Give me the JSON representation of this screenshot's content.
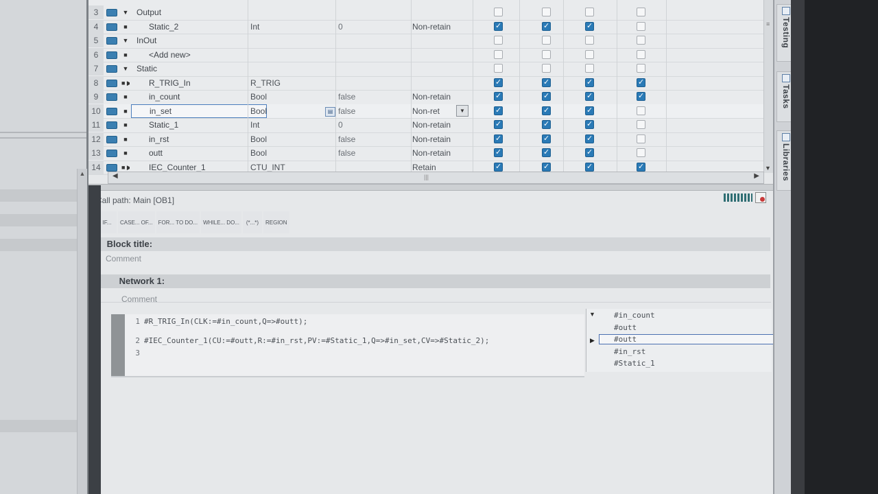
{
  "variables": [
    {
      "num": "3",
      "name": "Output",
      "type": "",
      "value": "",
      "retain": "",
      "tri": "▼",
      "indent": 0,
      "checks": [
        false,
        false,
        false,
        false
      ]
    },
    {
      "num": "4",
      "name": "Static_2",
      "type": "Int",
      "value": "0",
      "retain": "Non-retain",
      "tri": "■",
      "indent": 1,
      "checks": [
        true,
        true,
        true,
        false
      ]
    },
    {
      "num": "5",
      "name": "InOut",
      "type": "",
      "value": "",
      "retain": "",
      "tri": "▼",
      "indent": 0,
      "checks": [
        false,
        false,
        false,
        false
      ]
    },
    {
      "num": "6",
      "name": "<Add new>",
      "type": "",
      "value": "",
      "retain": "",
      "tri": "■",
      "indent": 1,
      "checks": [
        false,
        false,
        false,
        false
      ]
    },
    {
      "num": "7",
      "name": "Static",
      "type": "",
      "value": "",
      "retain": "",
      "tri": "▼",
      "indent": 0,
      "checks": [
        false,
        false,
        false,
        false
      ]
    },
    {
      "num": "8",
      "name": "R_TRIG_In",
      "type": "R_TRIG",
      "value": "",
      "retain": "",
      "tri": "■ ▶",
      "indent": 1,
      "checks": [
        true,
        true,
        true,
        true
      ]
    },
    {
      "num": "9",
      "name": "in_count",
      "type": "Bool",
      "value": "false",
      "retain": "Non-retain",
      "tri": "■",
      "indent": 1,
      "checks": [
        true,
        true,
        true,
        true
      ]
    },
    {
      "num": "10",
      "name": "in_set",
      "type": "Bool",
      "value": "false",
      "retain": "Non-ret",
      "tri": "■",
      "indent": 1,
      "checks": [
        true,
        true,
        true,
        false
      ]
    },
    {
      "num": "11",
      "name": "Static_1",
      "type": "Int",
      "value": "0",
      "retain": "Non-retain",
      "tri": "■",
      "indent": 1,
      "checks": [
        true,
        true,
        true,
        false
      ]
    },
    {
      "num": "12",
      "name": "in_rst",
      "type": "Bool",
      "value": "false",
      "retain": "Non-retain",
      "tri": "■",
      "indent": 1,
      "checks": [
        true,
        true,
        true,
        false
      ]
    },
    {
      "num": "13",
      "name": "outt",
      "type": "Bool",
      "value": "false",
      "retain": "Non-retain",
      "tri": "■",
      "indent": 1,
      "checks": [
        true,
        true,
        true,
        false
      ]
    },
    {
      "num": "14",
      "name": "IEC_Counter_1",
      "type": "CTU_INT",
      "value": "",
      "retain": "Retain",
      "tri": "■ ▶",
      "indent": 1,
      "checks": [
        true,
        true,
        true,
        true
      ]
    }
  ],
  "call_path": "Call path: Main [OB1]",
  "toolbar": [
    {
      "label": "IF...",
      "name": "if-button"
    },
    {
      "label": "CASE... OF...",
      "name": "case-of-button"
    },
    {
      "label": "FOR... TO DO...",
      "name": "for-to-do-button"
    },
    {
      "label": "WHILE... DO...",
      "name": "while-do-button"
    },
    {
      "label": "(*...*)",
      "name": "comment-block-button"
    },
    {
      "label": "REGION",
      "name": "region-button"
    }
  ],
  "block": {
    "title": "Block title:",
    "comment": "Comment"
  },
  "network": {
    "title": "Network 1:",
    "comment": "Comment"
  },
  "code_lines": [
    {
      "num": "1",
      "text": "#R_TRIG_In(CLK:=#in_count,Q=>#outt);"
    },
    {
      "num": "2",
      "text": "#IEC_Counter_1(CU:=#outt,R:=#in_rst,PV:=#Static_1,Q=>#in_set,CV=>#Static_2);"
    },
    {
      "num": "3",
      "text": ""
    }
  ],
  "autocomplete": [
    "#in_count",
    "#outt",
    "#outt",
    "#in_rst",
    "#Static_1"
  ],
  "side_tabs": [
    "Testing",
    "Tasks",
    "Libraries"
  ],
  "colors": {
    "checkbox_on": "#2a7ab6",
    "selection_border": "#4a7dbd",
    "background": "#e6e8ea"
  }
}
